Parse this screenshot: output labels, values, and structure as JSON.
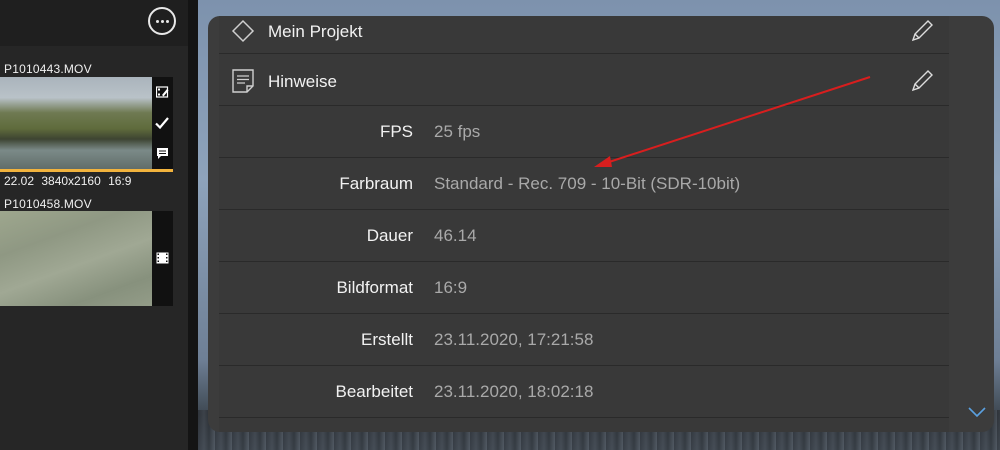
{
  "sidebar": {
    "clips": [
      {
        "name": "P1010443.MOV",
        "meta": "22.02  3840x2160  16:9"
      },
      {
        "name": "P1010458.MOV"
      }
    ]
  },
  "panel": {
    "project_title": "Mein Projekt",
    "notes_title": "Hinweise",
    "rows": [
      {
        "label": "FPS",
        "value": "25 fps"
      },
      {
        "label": "Farbraum",
        "value": "Standard - Rec. 709 - 10-Bit (SDR-10bit)"
      },
      {
        "label": "Dauer",
        "value": "46.14"
      },
      {
        "label": "Bildformat",
        "value": "16:9"
      },
      {
        "label": "Erstellt",
        "value": "23.11.2020, 17:21:58"
      },
      {
        "label": "Bearbeitet",
        "value": "23.11.2020, 18:02:18"
      }
    ]
  },
  "colors": {
    "accent": "#f2b33d",
    "annotation_arrow": "#d81e1e"
  },
  "icons": [
    "more-icon",
    "film-icon",
    "checkmark-icon",
    "comment-icon",
    "tag-icon",
    "notes-icon",
    "pencil-icon",
    "chevron-down-icon"
  ]
}
